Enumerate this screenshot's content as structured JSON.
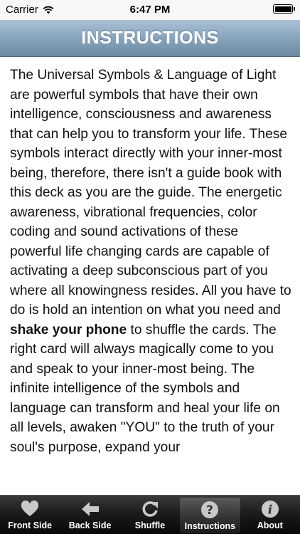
{
  "status_bar": {
    "carrier": "Carrier",
    "time": "6:47 PM",
    "wifi_icon": "wifi-icon",
    "battery_icon": "battery-icon"
  },
  "header": {
    "title": "INSTRUCTIONS"
  },
  "content": {
    "text_before_bold": "The Universal Symbols & Language of Light are powerful symbols that have their own intelligence, consciousness and awareness that can help you to transform your life. These symbols interact directly with your inner-most being, therefore, there isn't a guide book with this deck as you are the guide. The energetic awareness, vibrational frequencies, color coding and sound activations of these powerful life changing cards are capable of activating a deep subconscious part of you where all knowingness resides. All you have to do is hold an intention on what you need and ",
    "bold_text": "shake your phone",
    "text_after_bold": " to shuffle the cards. The right card will always magically come to you and speak to your inner-most being. The infinite intelligence of the symbols and language can transform and heal your life on all levels, awaken \"YOU\" to the truth of your soul's purpose, expand your"
  },
  "tab_bar": {
    "tabs": [
      {
        "label": "Front Side",
        "icon": "heart-icon",
        "active": false
      },
      {
        "label": "Back Side",
        "icon": "back-arrow-icon",
        "active": false
      },
      {
        "label": "Shuffle",
        "icon": "refresh-icon",
        "active": false
      },
      {
        "label": "Instructions",
        "icon": "question-icon",
        "active": true
      },
      {
        "label": "About",
        "icon": "info-icon",
        "active": false
      }
    ]
  },
  "colors": {
    "header_gradient_top": "#a9c1d6",
    "header_gradient_bottom": "#6d8aa4",
    "tab_bar_background": "#1c1c1c",
    "tab_icon_color": "#c8c8c8",
    "text_color": "#111111"
  }
}
